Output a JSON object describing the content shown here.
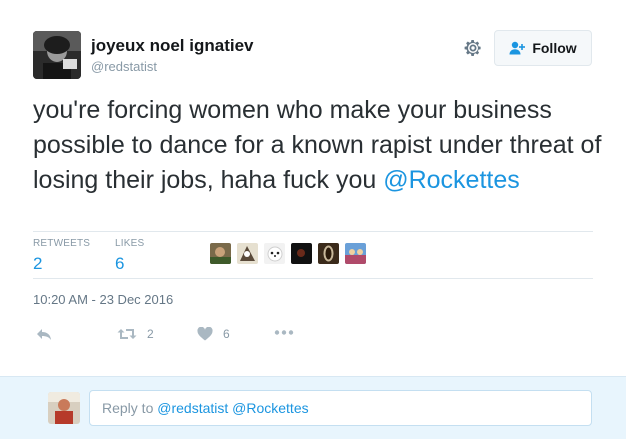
{
  "user": {
    "display_name": "joyeux noel ignatiev",
    "screen_name": "@redstatist"
  },
  "follow_button": {
    "label": "Follow"
  },
  "tweet": {
    "text": "you're forcing women who make your business possible to dance for a known rapist under threat of losing their jobs, haha fuck you",
    "mention": "@Rockettes"
  },
  "stats": {
    "retweets_label": "RETWEETS",
    "retweets_value": "2",
    "likes_label": "LIKES",
    "likes_value": "6"
  },
  "timestamp": "10:20 AM - 23 Dec 2016",
  "actions": {
    "retweet_count": "2",
    "like_count": "6"
  },
  "reply": {
    "prefix": "Reply to ",
    "mentions": "@redstatist @Rockettes"
  },
  "icons": {
    "gear": "gear-icon",
    "follow": "add-user-icon",
    "reply": "reply-icon",
    "retweet": "retweet-icon",
    "like": "heart-icon",
    "more": "more-icon"
  },
  "colors": {
    "link": "#1b95e0",
    "muted": "#8899a6",
    "reply_bar": "#e8f5fd",
    "icon": "#aab8c2"
  }
}
